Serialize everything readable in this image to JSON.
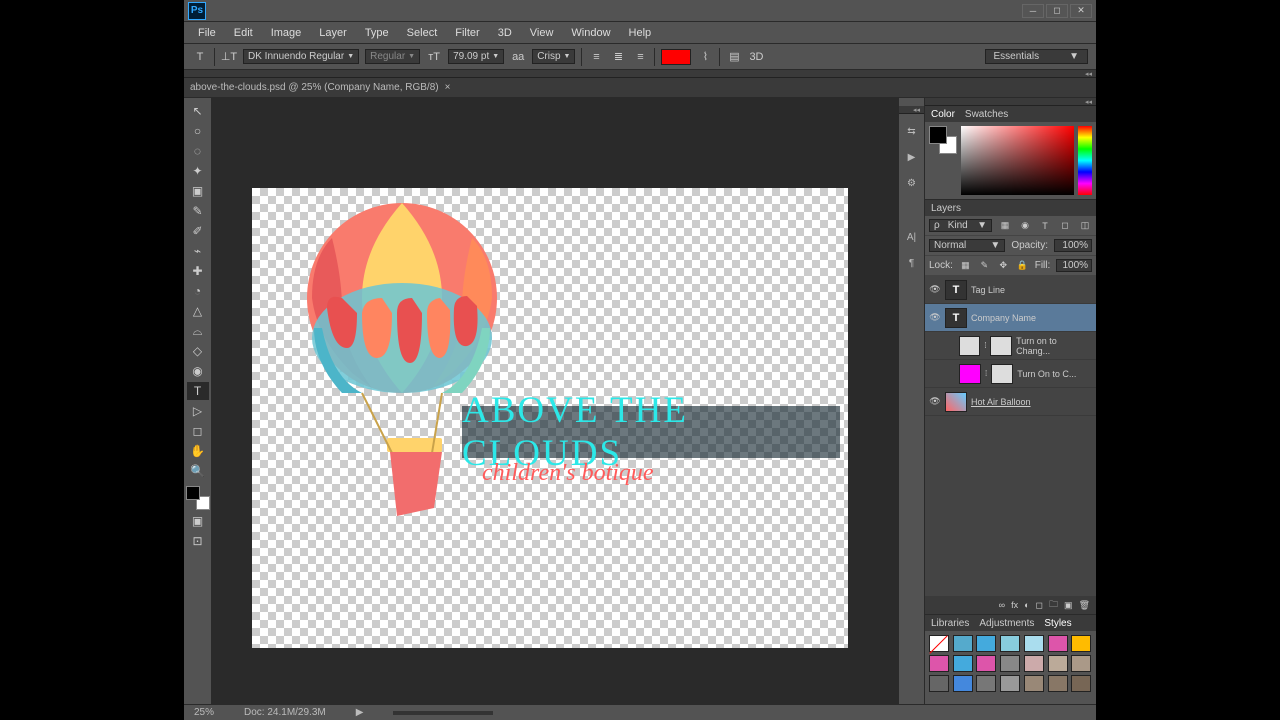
{
  "app": {
    "title": "Ps"
  },
  "window": {
    "minimize": "─",
    "maximize": "◻",
    "close": "✕"
  },
  "menus": [
    "File",
    "Edit",
    "Image",
    "Layer",
    "Type",
    "Select",
    "Filter",
    "3D",
    "View",
    "Window",
    "Help"
  ],
  "options": {
    "font": "DK Innuendo Regular",
    "weight": "Regular",
    "size": "79.09 pt",
    "aa": "Crisp",
    "color": "#ff0000"
  },
  "workspace": "Essentials",
  "tab": {
    "title": "above-the-clouds.psd @ 25% (Company Name, RGB/8)"
  },
  "tools": [
    "↖",
    "○",
    "◌",
    "✦",
    "▣",
    "✎",
    "✐",
    "⌁",
    "✚",
    "◔",
    "△",
    "⌓",
    "◇",
    "◉",
    "T",
    "▷",
    "◻",
    "✋",
    "🔍"
  ],
  "activeTool": 14,
  "rightIcons": [
    "⇆",
    "▶",
    "⚙",
    "",
    "A|",
    "¶"
  ],
  "colorTabs": [
    "Color",
    "Swatches"
  ],
  "layersTab": "Layers",
  "layerFilter": {
    "kind": "Kind",
    "icons": [
      "▦",
      "◉",
      "T",
      "◻",
      "◫"
    ]
  },
  "blendMode": "Normal",
  "opacity": {
    "label": "Opacity:",
    "value": "100%"
  },
  "lock": {
    "label": "Lock:",
    "icons": [
      "▦",
      "✎",
      "✥",
      "🔒"
    ]
  },
  "fill": {
    "label": "Fill:",
    "value": "100%"
  },
  "layers": [
    {
      "vis": true,
      "type": "T",
      "name": "Tag Line",
      "sel": false
    },
    {
      "vis": true,
      "type": "T",
      "name": "Company Name",
      "sel": true
    },
    {
      "vis": false,
      "type": "mask",
      "name": "Turn on to Chang...",
      "sel": false
    },
    {
      "vis": false,
      "type": "pink",
      "name": "Turn On to C...",
      "sel": false
    },
    {
      "vis": true,
      "type": "img",
      "name": "Hot Air Balloon",
      "sel": false,
      "underline": true
    }
  ],
  "layerFoot": [
    "∞",
    "fx",
    "◐",
    "◻",
    "🗀",
    "▣",
    "🗑"
  ],
  "styleTabs": [
    "Libraries",
    "Adjustments",
    "Styles"
  ],
  "swatches": [
    "#fff",
    "#5ac",
    "#4ad",
    "#8cd",
    "#ade",
    "#d5a",
    "#fb0",
    "#d5a",
    "#4ad",
    "#d5a",
    "#888",
    "#caa",
    "#ba9",
    "#a98",
    "#666",
    "#48d",
    "#777",
    "#999",
    "#987",
    "#876",
    "#765"
  ],
  "canvasText": {
    "main": "ABOVE THE CLOUDS",
    "tag": "children's botique"
  },
  "status": {
    "zoom": "25%",
    "doc": "Doc: 24.1M/29.3M"
  }
}
